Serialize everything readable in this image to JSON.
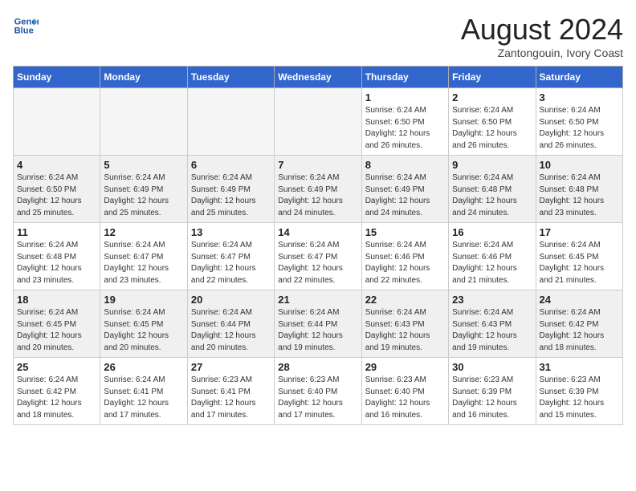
{
  "logo": {
    "line1": "General",
    "line2": "Blue"
  },
  "title": "August 2024",
  "location": "Zantongouin, Ivory Coast",
  "days_of_week": [
    "Sunday",
    "Monday",
    "Tuesday",
    "Wednesday",
    "Thursday",
    "Friday",
    "Saturday"
  ],
  "weeks": [
    [
      {
        "day": "",
        "info": ""
      },
      {
        "day": "",
        "info": ""
      },
      {
        "day": "",
        "info": ""
      },
      {
        "day": "",
        "info": ""
      },
      {
        "day": "1",
        "info": "Sunrise: 6:24 AM\nSunset: 6:50 PM\nDaylight: 12 hours\nand 26 minutes."
      },
      {
        "day": "2",
        "info": "Sunrise: 6:24 AM\nSunset: 6:50 PM\nDaylight: 12 hours\nand 26 minutes."
      },
      {
        "day": "3",
        "info": "Sunrise: 6:24 AM\nSunset: 6:50 PM\nDaylight: 12 hours\nand 26 minutes."
      }
    ],
    [
      {
        "day": "4",
        "info": "Sunrise: 6:24 AM\nSunset: 6:50 PM\nDaylight: 12 hours\nand 25 minutes."
      },
      {
        "day": "5",
        "info": "Sunrise: 6:24 AM\nSunset: 6:49 PM\nDaylight: 12 hours\nand 25 minutes."
      },
      {
        "day": "6",
        "info": "Sunrise: 6:24 AM\nSunset: 6:49 PM\nDaylight: 12 hours\nand 25 minutes."
      },
      {
        "day": "7",
        "info": "Sunrise: 6:24 AM\nSunset: 6:49 PM\nDaylight: 12 hours\nand 24 minutes."
      },
      {
        "day": "8",
        "info": "Sunrise: 6:24 AM\nSunset: 6:49 PM\nDaylight: 12 hours\nand 24 minutes."
      },
      {
        "day": "9",
        "info": "Sunrise: 6:24 AM\nSunset: 6:48 PM\nDaylight: 12 hours\nand 24 minutes."
      },
      {
        "day": "10",
        "info": "Sunrise: 6:24 AM\nSunset: 6:48 PM\nDaylight: 12 hours\nand 23 minutes."
      }
    ],
    [
      {
        "day": "11",
        "info": "Sunrise: 6:24 AM\nSunset: 6:48 PM\nDaylight: 12 hours\nand 23 minutes."
      },
      {
        "day": "12",
        "info": "Sunrise: 6:24 AM\nSunset: 6:47 PM\nDaylight: 12 hours\nand 23 minutes."
      },
      {
        "day": "13",
        "info": "Sunrise: 6:24 AM\nSunset: 6:47 PM\nDaylight: 12 hours\nand 22 minutes."
      },
      {
        "day": "14",
        "info": "Sunrise: 6:24 AM\nSunset: 6:47 PM\nDaylight: 12 hours\nand 22 minutes."
      },
      {
        "day": "15",
        "info": "Sunrise: 6:24 AM\nSunset: 6:46 PM\nDaylight: 12 hours\nand 22 minutes."
      },
      {
        "day": "16",
        "info": "Sunrise: 6:24 AM\nSunset: 6:46 PM\nDaylight: 12 hours\nand 21 minutes."
      },
      {
        "day": "17",
        "info": "Sunrise: 6:24 AM\nSunset: 6:45 PM\nDaylight: 12 hours\nand 21 minutes."
      }
    ],
    [
      {
        "day": "18",
        "info": "Sunrise: 6:24 AM\nSunset: 6:45 PM\nDaylight: 12 hours\nand 20 minutes."
      },
      {
        "day": "19",
        "info": "Sunrise: 6:24 AM\nSunset: 6:45 PM\nDaylight: 12 hours\nand 20 minutes."
      },
      {
        "day": "20",
        "info": "Sunrise: 6:24 AM\nSunset: 6:44 PM\nDaylight: 12 hours\nand 20 minutes."
      },
      {
        "day": "21",
        "info": "Sunrise: 6:24 AM\nSunset: 6:44 PM\nDaylight: 12 hours\nand 19 minutes."
      },
      {
        "day": "22",
        "info": "Sunrise: 6:24 AM\nSunset: 6:43 PM\nDaylight: 12 hours\nand 19 minutes."
      },
      {
        "day": "23",
        "info": "Sunrise: 6:24 AM\nSunset: 6:43 PM\nDaylight: 12 hours\nand 19 minutes."
      },
      {
        "day": "24",
        "info": "Sunrise: 6:24 AM\nSunset: 6:42 PM\nDaylight: 12 hours\nand 18 minutes."
      }
    ],
    [
      {
        "day": "25",
        "info": "Sunrise: 6:24 AM\nSunset: 6:42 PM\nDaylight: 12 hours\nand 18 minutes."
      },
      {
        "day": "26",
        "info": "Sunrise: 6:24 AM\nSunset: 6:41 PM\nDaylight: 12 hours\nand 17 minutes."
      },
      {
        "day": "27",
        "info": "Sunrise: 6:23 AM\nSunset: 6:41 PM\nDaylight: 12 hours\nand 17 minutes."
      },
      {
        "day": "28",
        "info": "Sunrise: 6:23 AM\nSunset: 6:40 PM\nDaylight: 12 hours\nand 17 minutes."
      },
      {
        "day": "29",
        "info": "Sunrise: 6:23 AM\nSunset: 6:40 PM\nDaylight: 12 hours\nand 16 minutes."
      },
      {
        "day": "30",
        "info": "Sunrise: 6:23 AM\nSunset: 6:39 PM\nDaylight: 12 hours\nand 16 minutes."
      },
      {
        "day": "31",
        "info": "Sunrise: 6:23 AM\nSunset: 6:39 PM\nDaylight: 12 hours\nand 15 minutes."
      }
    ]
  ]
}
